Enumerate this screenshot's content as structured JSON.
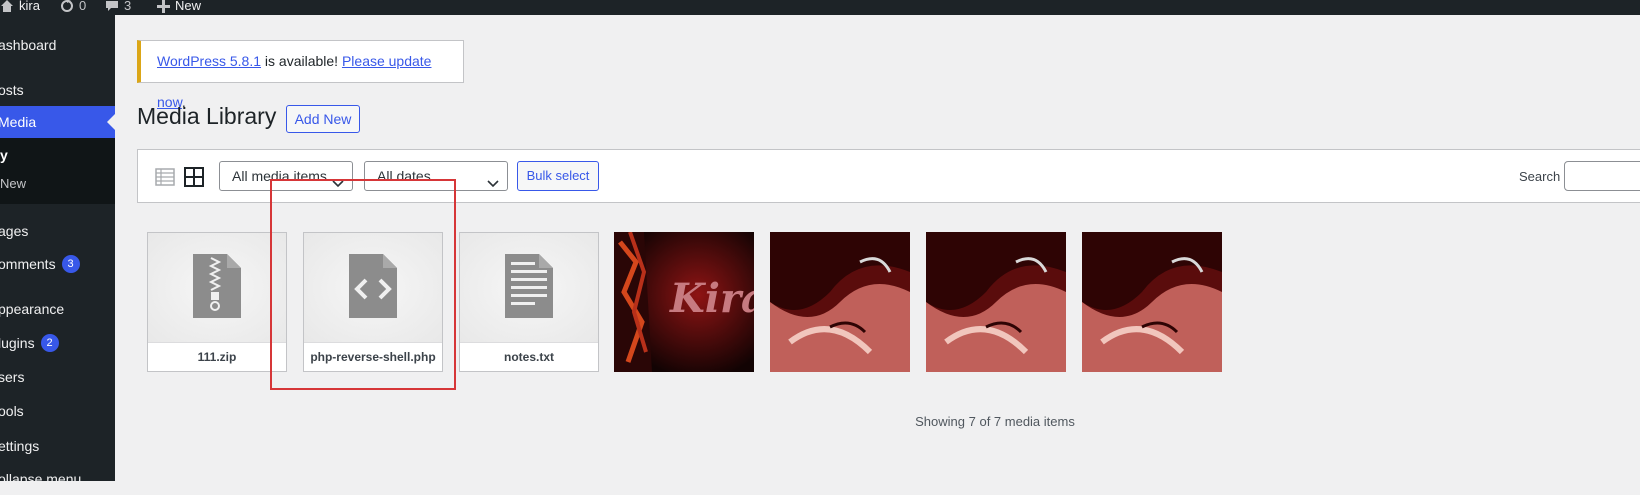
{
  "adminbar": {
    "site_name": "kira",
    "updates_count": "0",
    "comments_count": "3",
    "new_label": "New"
  },
  "sidebar": {
    "items": [
      {
        "label": "ashboard"
      },
      {
        "label": "osts"
      },
      {
        "label": "Media",
        "current": true
      },
      {
        "label": "ages"
      },
      {
        "label": "omments",
        "badge": "3"
      },
      {
        "label": "ppearance"
      },
      {
        "label": "lugins",
        "badge": "2"
      },
      {
        "label": "sers"
      },
      {
        "label": "ools"
      },
      {
        "label": "ettings"
      },
      {
        "label": "ollapse menu"
      }
    ],
    "submenu": [
      {
        "label": "y"
      },
      {
        "label": "New"
      }
    ]
  },
  "notice": {
    "version_link": "WordPress 5.8.1",
    "middle_text": " is available! ",
    "update_link": "Please update now",
    "end_text": "."
  },
  "page": {
    "title": "Media Library",
    "add_new": "Add New"
  },
  "toolbar": {
    "media_filter": "All media items",
    "date_filter": "All dates",
    "bulk_select": "Bulk select",
    "search_label": "Search",
    "search_value": ""
  },
  "media": [
    {
      "name": "111.zip",
      "kind": "archive",
      "icon": "archive-icon"
    },
    {
      "name": "php-reverse-shell.php",
      "kind": "code",
      "icon": "code-icon"
    },
    {
      "name": "notes.txt",
      "kind": "document",
      "icon": "document-icon"
    },
    {
      "name": "",
      "kind": "image",
      "icon": "kira-image"
    },
    {
      "name": "",
      "kind": "image",
      "icon": "anime-image"
    },
    {
      "name": "",
      "kind": "image",
      "icon": "anime-image"
    },
    {
      "name": "",
      "kind": "image",
      "icon": "anime-image"
    }
  ],
  "image_text": "Kira",
  "status": {
    "count_text": "Showing 7 of 7 media items"
  },
  "colors": {
    "accent": "#3858e9",
    "admin_dark": "#1d2327",
    "notice_warning": "#dba617",
    "highlight": "#d63638"
  }
}
